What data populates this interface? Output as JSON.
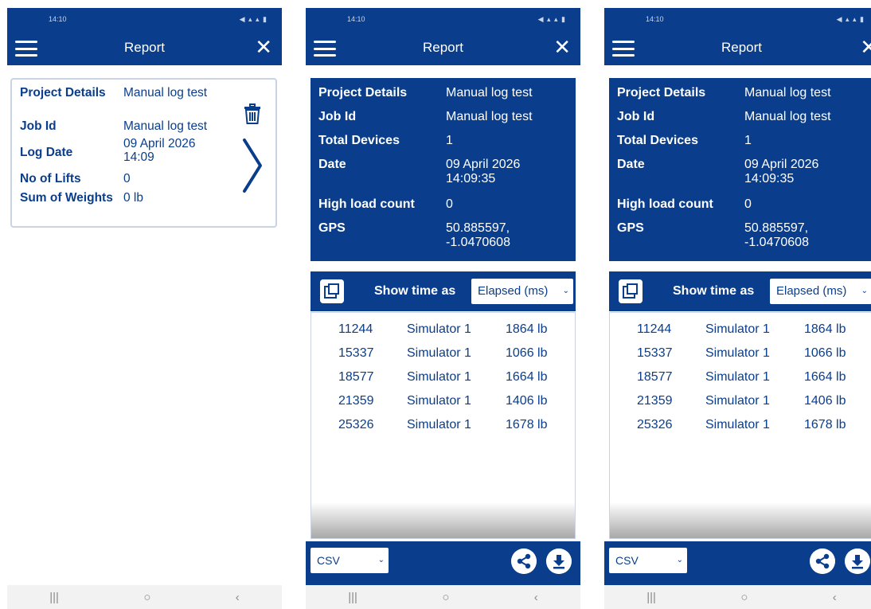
{
  "status_bar": {
    "time": "14:10",
    "icons": "◀ ▴ ▴ ▮"
  },
  "app_bar": {
    "title": "Report"
  },
  "log_card": {
    "project_label": "Project Details",
    "project_value": "Manual log test",
    "job_label": "Job Id",
    "job_value": "Manual log test",
    "date_label": "Log Date",
    "date_value": "09 April 2026 14:09",
    "lifts_label": "No of Lifts",
    "lifts_value": "0",
    "weights_label": "Sum of Weights",
    "weights_value": "0 lb"
  },
  "report": {
    "project_label": "Project Details",
    "project_value": "Manual log test",
    "job_label": "Job Id",
    "job_value": "Manual log test",
    "devices_label": "Total Devices",
    "devices_value": "1",
    "date_label": "Date",
    "date_value": "09 April 2026 14:09:35",
    "high_load_label": "High load count",
    "high_load_value": "0",
    "gps_label": "GPS",
    "gps_value": "50.885597, -1.0470608"
  },
  "toolbar": {
    "show_time_label": "Show time as",
    "time_selected": "Elapsed (ms)"
  },
  "readings": [
    {
      "time": "11244",
      "device": "Simulator 1",
      "weight": "1864 lb"
    },
    {
      "time": "15337",
      "device": "Simulator 1",
      "weight": "1066 lb"
    },
    {
      "time": "18577",
      "device": "Simulator 1",
      "weight": "1664 lb"
    },
    {
      "time": "21359",
      "device": "Simulator 1",
      "weight": "1406 lb"
    },
    {
      "time": "25326",
      "device": "Simulator 1",
      "weight": "1678 lb"
    }
  ],
  "export": {
    "format_selected": "CSV"
  },
  "nav": {
    "recents": "|||",
    "home": "○",
    "back": "‹"
  },
  "colors": {
    "primary": "#0a3e8c",
    "card_border": "#c9d3e3",
    "nav_bg": "#f2f2f2"
  }
}
